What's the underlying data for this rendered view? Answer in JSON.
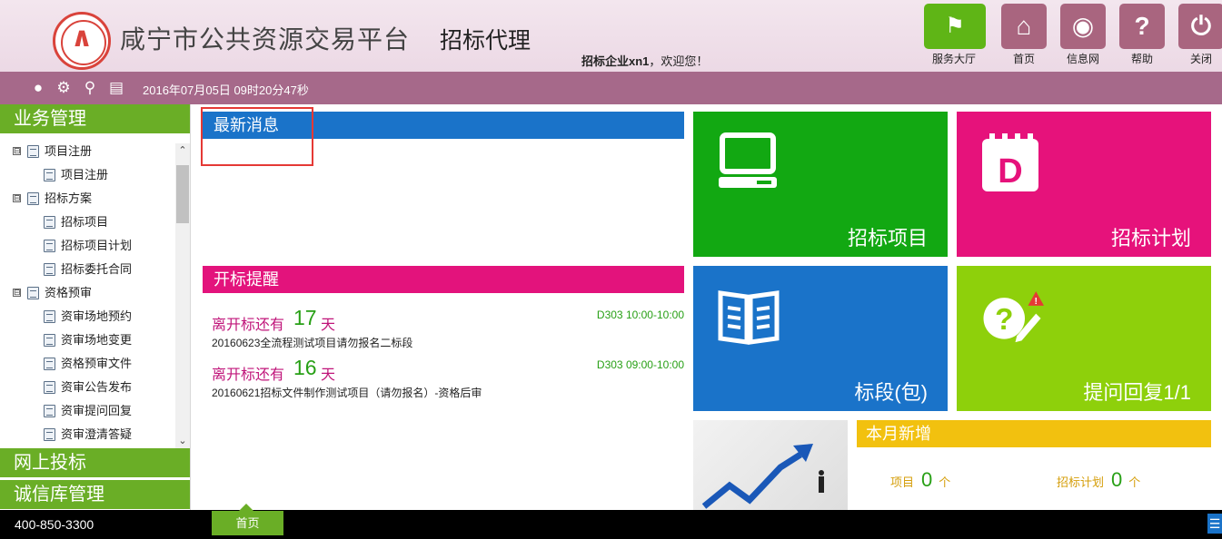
{
  "header": {
    "site_title": "咸宁市公共资源交易平台",
    "role_title": "招标代理",
    "welcome_user": "招标企业xn1",
    "welcome_suffix": "，欢迎您！",
    "nav": [
      {
        "label": "服务大厅",
        "icon": "service-hall-icon"
      },
      {
        "label": "首页",
        "icon": "home-icon"
      },
      {
        "label": "信息网",
        "icon": "globe-icon"
      },
      {
        "label": "帮助",
        "icon": "help-icon"
      },
      {
        "label": "关闭",
        "icon": "power-icon"
      }
    ]
  },
  "toolbar": {
    "datetime": "2016年07月05日 09时20分47秒"
  },
  "sidebar": {
    "sections": [
      "业务管理",
      "网上投标",
      "诚信库管理"
    ],
    "tree": [
      {
        "label": "项目注册",
        "level": 0,
        "expander": "⊟"
      },
      {
        "label": "项目注册",
        "level": 1
      },
      {
        "label": "招标方案",
        "level": 0,
        "expander": "⊟"
      },
      {
        "label": "招标项目",
        "level": 1
      },
      {
        "label": "招标项目计划",
        "level": 1
      },
      {
        "label": "招标委托合同",
        "level": 1
      },
      {
        "label": "资格预审",
        "level": 0,
        "expander": "⊟"
      },
      {
        "label": "资审场地预约",
        "level": 1
      },
      {
        "label": "资审场地变更",
        "level": 1
      },
      {
        "label": "资格预审文件",
        "level": 1
      },
      {
        "label": "资审公告发布",
        "level": 1
      },
      {
        "label": "资审提问回复",
        "level": 1
      },
      {
        "label": "资审澄清答疑",
        "level": 1
      }
    ]
  },
  "news": {
    "title": "最新消息"
  },
  "reminder": {
    "title": "开标提醒",
    "items": [
      {
        "prefix": "离开标还有",
        "days": "17",
        "unit": "天",
        "room": "D303 10:00-10:00",
        "name": "20160623全流程测试项目请勿报名二标段"
      },
      {
        "prefix": "离开标还有",
        "days": "16",
        "unit": "天",
        "room": "D303 09:00-10:00",
        "name": "20160621招标文件制作测试项目（请勿报名）-资格后审"
      }
    ]
  },
  "tiles": [
    {
      "label": "招标项目",
      "color": "#12a812"
    },
    {
      "label": "招标计划",
      "color": "#e6127b"
    },
    {
      "label": "标段(包)",
      "color": "#1a73c9"
    },
    {
      "label": "提问回复1/1",
      "color": "#8ed00b"
    }
  ],
  "monthly": {
    "title": "本月新增",
    "stats": [
      {
        "label": "项目",
        "value": "0",
        "unit": "个"
      },
      {
        "label": "招标计划",
        "value": "0",
        "unit": "个"
      }
    ]
  },
  "footer": {
    "phone": "400-850-3300",
    "home_tab": "首页"
  }
}
